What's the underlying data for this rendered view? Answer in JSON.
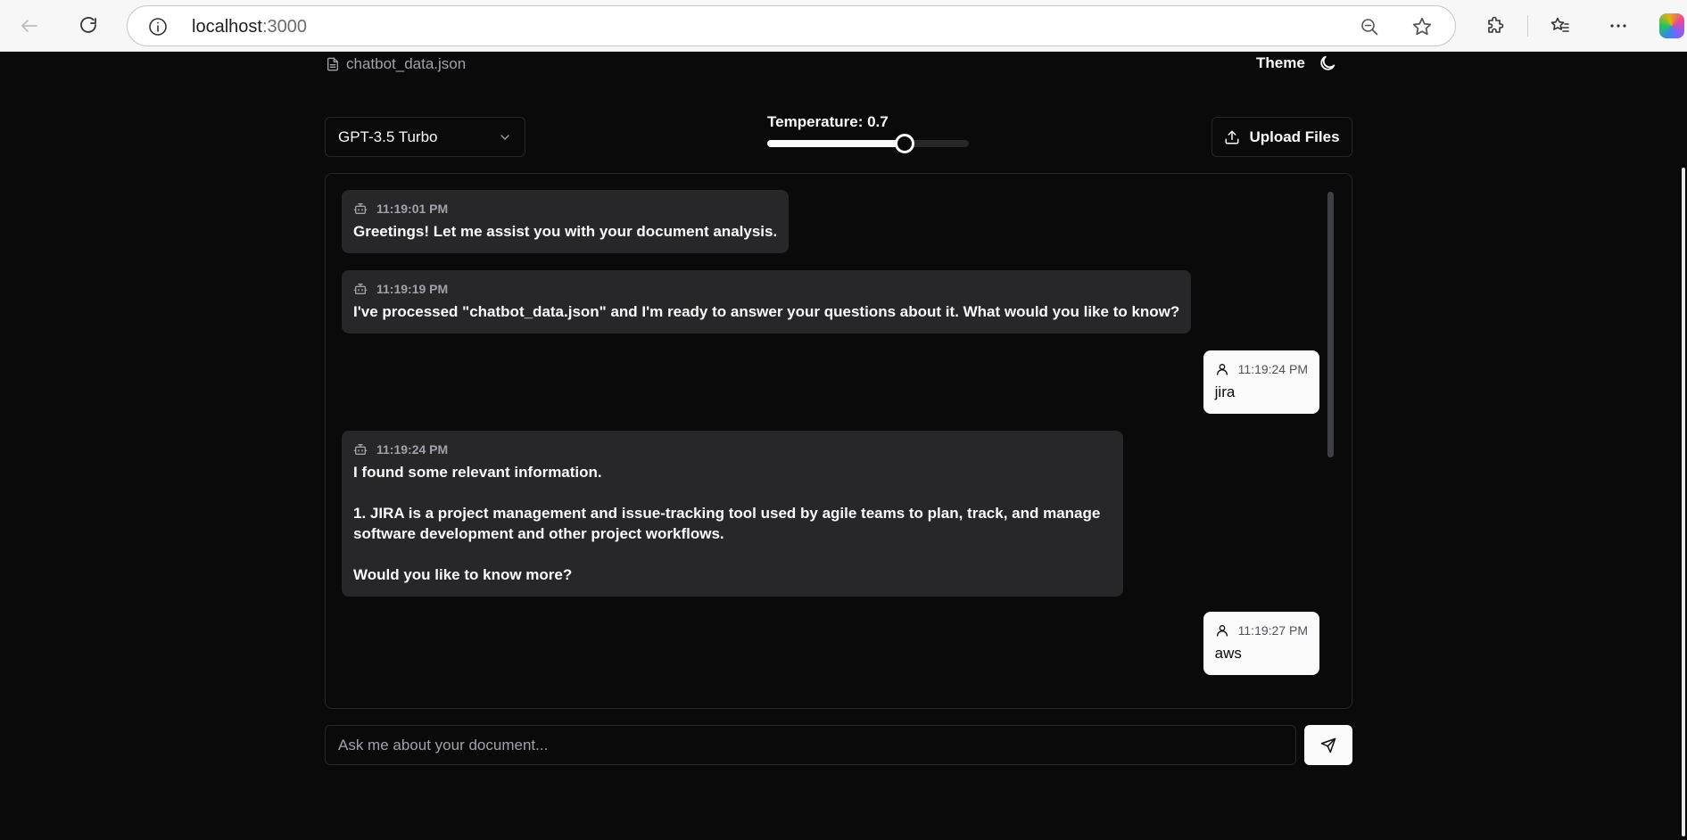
{
  "browser": {
    "url_host": "localhost",
    "url_port": ":3000"
  },
  "header": {
    "file_name": "chatbot_data.json",
    "theme_label": "Theme"
  },
  "controls": {
    "model": "GPT-3.5 Turbo",
    "temperature_label": "Temperature: 0.7",
    "temperature_fraction": 0.68,
    "upload_label": "Upload Files"
  },
  "messages": [
    {
      "role": "bot",
      "time": "11:19:01 PM",
      "text": "Greetings! Let me assist you with your document analysis."
    },
    {
      "role": "bot",
      "time": "11:19:19 PM",
      "text": "I've processed \"chatbot_data.json\" and I'm ready to answer your questions about it. What would you like to know?"
    },
    {
      "role": "user",
      "time": "11:19:24 PM",
      "text": "jira"
    },
    {
      "role": "bot",
      "time": "11:19:24 PM",
      "text": "I found some relevant information.\n\n1. JIRA is a project management and issue-tracking tool used by agile teams to plan, track, and manage software development and other project workflows.\n\nWould you like to know more?"
    },
    {
      "role": "user",
      "time": "11:19:27 PM",
      "text": "aws"
    }
  ],
  "input": {
    "placeholder": "Ask me about your document..."
  }
}
